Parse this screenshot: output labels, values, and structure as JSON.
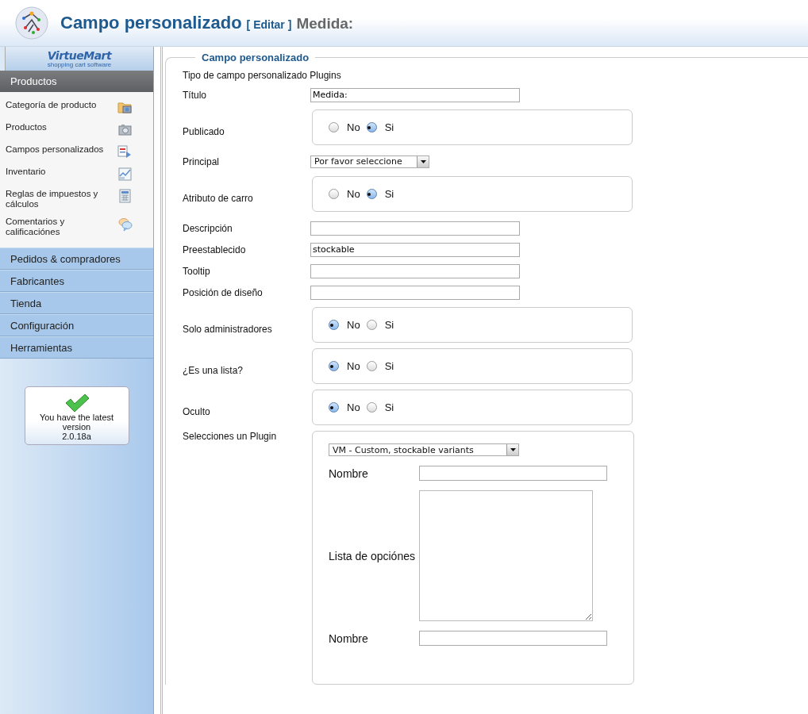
{
  "header": {
    "title": "Campo personalizado",
    "edit_link": "[ Editar ]",
    "subtitle": "Medida:"
  },
  "sidebar": {
    "logo": {
      "name": "VirtueMart",
      "tagline": "shopping cart software"
    },
    "sections": [
      {
        "label": "Productos",
        "expanded": true,
        "items": [
          {
            "label": "Categoría de producto"
          },
          {
            "label": "Productos"
          },
          {
            "label": "Campos personalizados"
          },
          {
            "label": "Inventario"
          },
          {
            "label": "Reglas de impuestos y cálculos"
          },
          {
            "label": "Comentarios y calificaciónes"
          }
        ]
      },
      {
        "label": "Pedidos & compradores",
        "expanded": false
      },
      {
        "label": "Fabricantes",
        "expanded": false
      },
      {
        "label": "Tienda",
        "expanded": false
      },
      {
        "label": "Configuración",
        "expanded": false
      },
      {
        "label": "Herramientas",
        "expanded": false
      }
    ],
    "version_box": {
      "message": "You have the latest version",
      "version": "2.0.18a"
    }
  },
  "form": {
    "legend": "Campo personalizado",
    "type_line": "Tipo de campo personalizado Plugins",
    "rows": [
      {
        "kind": "text",
        "label": "Título",
        "value": "Medida:"
      },
      {
        "kind": "radio",
        "label": "Publicado",
        "options": [
          {
            "label": "No",
            "selected": false
          },
          {
            "label": "Si",
            "selected": true
          }
        ]
      },
      {
        "kind": "select",
        "label": "Principal",
        "value": "Por favor seleccione"
      },
      {
        "kind": "radio",
        "label": "Atributo de carro",
        "options": [
          {
            "label": "No",
            "selected": false
          },
          {
            "label": "Si",
            "selected": true
          }
        ]
      },
      {
        "kind": "text",
        "label": "Descripción"
      },
      {
        "kind": "text",
        "label": "Preestablecido",
        "value": "stockable"
      },
      {
        "kind": "text",
        "label": "Tooltip"
      },
      {
        "kind": "text",
        "label": "Posición de diseño"
      },
      {
        "kind": "radio",
        "label": "Solo administradores",
        "options": [
          {
            "label": "No",
            "selected": true
          },
          {
            "label": "Si",
            "selected": false
          }
        ]
      },
      {
        "kind": "radio",
        "label": "¿Es una lista?",
        "options": [
          {
            "label": "No",
            "selected": true
          },
          {
            "label": "Si",
            "selected": false
          }
        ]
      },
      {
        "kind": "radio",
        "label": "Oculto",
        "options": [
          {
            "label": "No",
            "selected": true
          },
          {
            "label": "Si",
            "selected": false
          }
        ]
      }
    ],
    "plugin": {
      "label": "Selecciones un Plugin",
      "value": "VM - Custom, stockable variants",
      "fields": [
        {
          "kind": "text",
          "label": "Nombre"
        },
        {
          "kind": "textarea",
          "label": "Lista de opciónes"
        },
        {
          "kind": "text",
          "label": "Nombre"
        }
      ]
    }
  }
}
